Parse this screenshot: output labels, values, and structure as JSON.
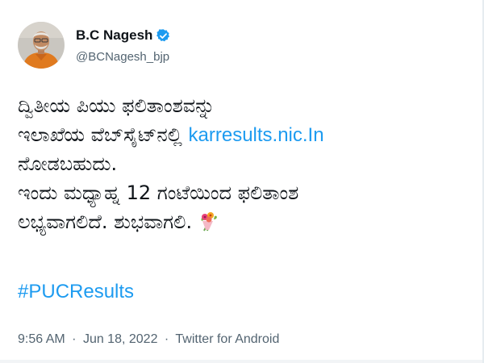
{
  "author": {
    "display_name": "B.C Nagesh",
    "handle": "@BCNagesh_bjp",
    "verified": true,
    "avatar_icon": "profile-photo"
  },
  "tweet": {
    "line1": "ದ್ವಿತೀಯ ಪಿಯು ಫಲಿತಾಂಶವನ್ನು",
    "line2_text": "ಇಲಾಖೆಯ ವೆಬ್‌ಸೈಟ್‌ನಲ್ಲಿ ",
    "line2_link": "karresults.nic.In",
    "line3": "ನೋಡಬಹುದು.",
    "line4": "ಇಂದು ಮಧ್ಯಾಹ್ನ 12 ಗಂಟೆಯಿಂದ ಫಲಿತಾಂಶ",
    "line5": "ಲಭ್ಯವಾಗಲಿದೆ. ಶುಭವಾಗಲಿ.",
    "emoji": "bouquet-icon",
    "hashtag": "#PUCResults"
  },
  "meta": {
    "time": "9:56 AM",
    "separator": "·",
    "date": "Jun 18, 2022",
    "source": "Twitter for Android"
  },
  "colors": {
    "link": "#1d9bf0",
    "text": "#0f1419",
    "muted": "#536471",
    "verified": "#1d9bf0"
  }
}
